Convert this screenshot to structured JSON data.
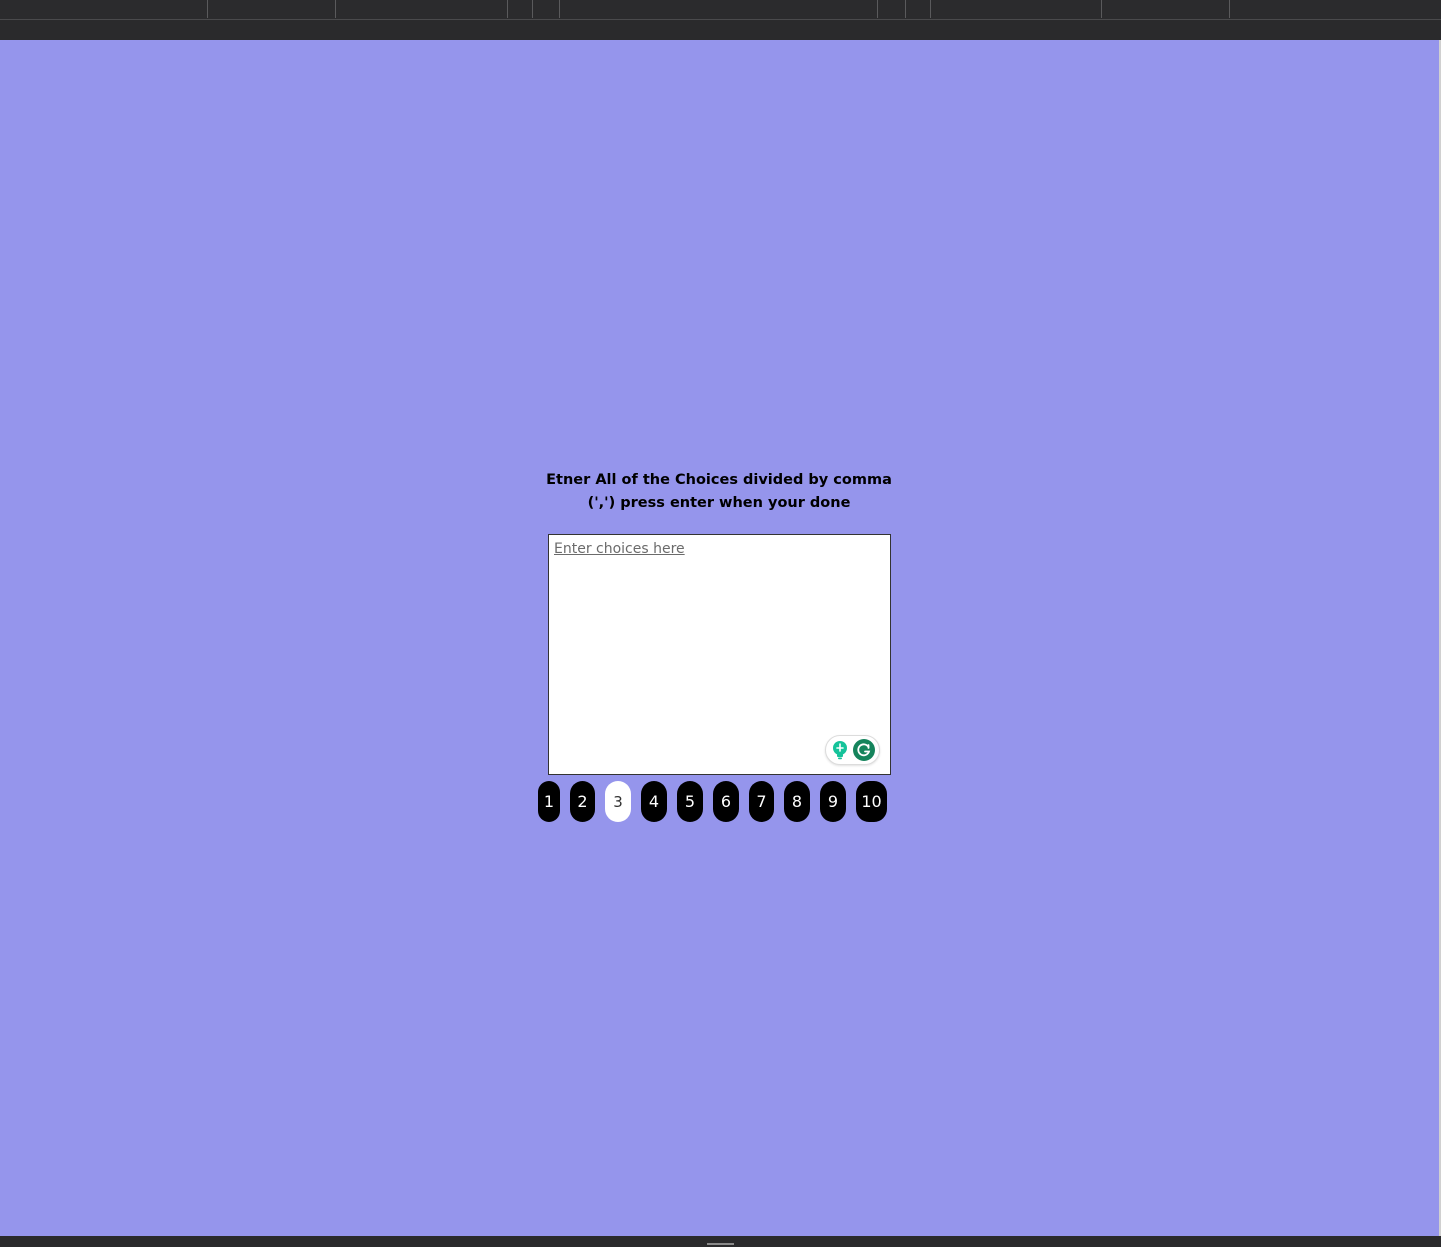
{
  "page": {
    "background_color": "#9595ec",
    "chrome_color": "#2a2a2c"
  },
  "prompt": {
    "line1": "Etner All of the Choices divided by comma",
    "line2": "(',') press enter when your done"
  },
  "choices_input": {
    "placeholder": "Enter choices here",
    "value": ""
  },
  "grammarly": {
    "bulb_icon": "lightbulb-icon",
    "logo_icon": "grammarly-g-icon",
    "accent": "#15845c"
  },
  "pager": {
    "pages": [
      "1",
      "2",
      "3",
      "4",
      "5",
      "6",
      "7",
      "8",
      "9",
      "10"
    ],
    "active": "3"
  }
}
